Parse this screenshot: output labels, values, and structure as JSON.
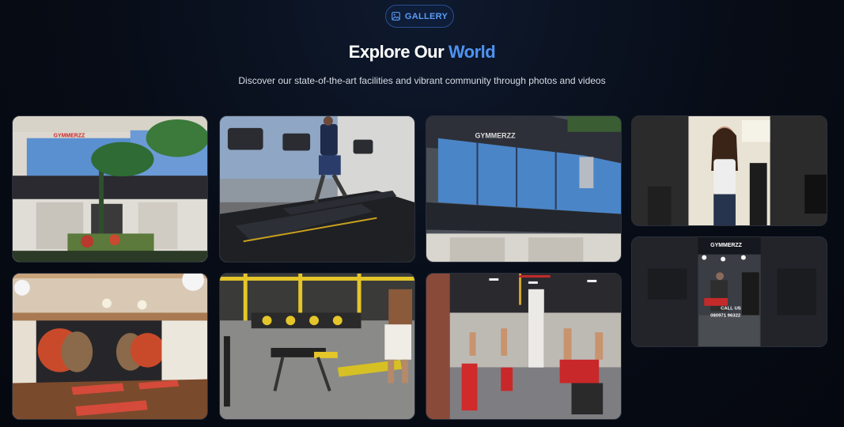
{
  "section": {
    "badge_label": "GALLERY",
    "badge_icon": "image-icon",
    "title_main": "Explore Our",
    "title_accent": "World",
    "subtitle": "Discover our state-of-the-art facilities and vibrant community through photos and videos"
  },
  "gallery": {
    "photos": [
      {
        "name": "gym-exterior-photo",
        "sign": "GYMMERZZ"
      },
      {
        "name": "treadmill-photo",
        "sign": ""
      },
      {
        "name": "gym-facade-photo",
        "sign": "GYMMERZZ"
      },
      {
        "name": "yoga-studio-photo",
        "sign": ""
      },
      {
        "name": "weights-area-photo",
        "sign": ""
      },
      {
        "name": "strength-floor-photo",
        "sign": ""
      }
    ],
    "videos": [
      {
        "name": "promo-video-1",
        "caption": ""
      },
      {
        "name": "promo-video-2",
        "brand": "GYMMERZZ",
        "caption": "CALL US",
        "phone": "080971 96322"
      }
    ]
  },
  "colors": {
    "accent": "#4f93f2",
    "badge_border": "#2a4f8f",
    "background": "#070c16"
  }
}
